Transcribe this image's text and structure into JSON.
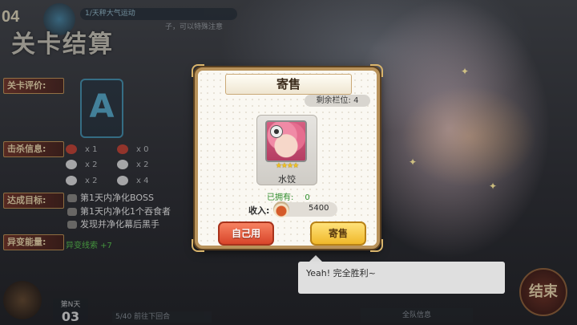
{
  "hud": {
    "level_number": "04",
    "top_tag": "1/天秤大气运动",
    "top_subtitle": "子，可以特殊注意",
    "stage_title": "关卡结算"
  },
  "result": {
    "rating_label": "关卡评价:",
    "grade": "A",
    "kill_label": "击杀信息:",
    "kills": [
      "x 1",
      "x 0",
      "x 2",
      "x 2",
      "x 2",
      "x 4"
    ],
    "goal_label": "达成目标:",
    "goals": [
      "第1天内净化BOSS",
      "第1天内净化1个吞食者",
      "发现并净化幕后黑手"
    ],
    "energy_label": "异变能量:",
    "energy_value": "异变线索 +7"
  },
  "bottom": {
    "day_label": "第N天",
    "day_number": "03",
    "bar_left": "5/40 前往下回合",
    "end_button": "结束",
    "bar_right": "全队信息"
  },
  "speech": {
    "text": "Yeah!  完全胜利~"
  },
  "popup": {
    "title": "寄售",
    "remaining_slots": "剩余栏位: 4",
    "item": {
      "name": "水饺",
      "stars": "★★★★",
      "rarity_stars": 4
    },
    "owned_label": "已拥有:",
    "owned_value": "0",
    "income_label": "收入:",
    "income_value": "5400",
    "self_use_button": "自己用",
    "sell_button": "寄售"
  },
  "colors": {
    "popup_border": "#b8925a",
    "self_use_button": "#e45a38",
    "sell_button": "#f4c93f",
    "owned_text": "#2e8d2b",
    "grade": "#57c6ef"
  },
  "icons": {
    "coin": "coin-icon",
    "portrait_badge": "character-badge-icon"
  }
}
